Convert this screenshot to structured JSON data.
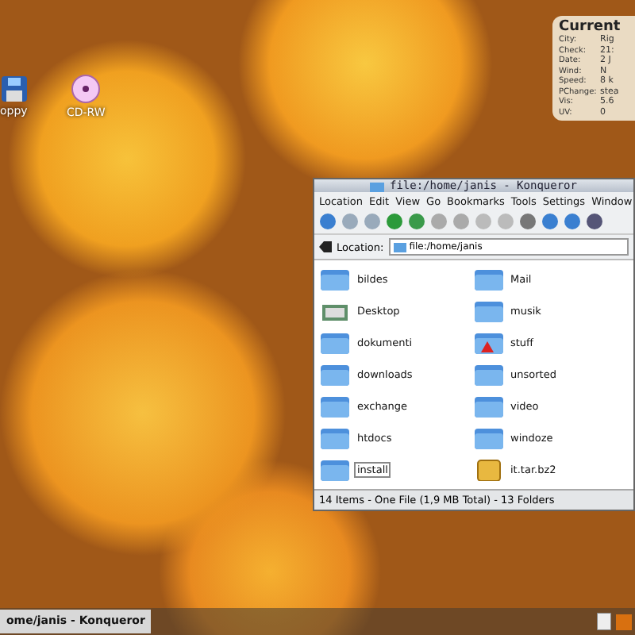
{
  "desktop_icons": [
    {
      "label": "oppy",
      "kind": "floppy"
    },
    {
      "label": "CD-RW",
      "kind": "cd"
    }
  ],
  "weather_widget": {
    "title": "Current",
    "rows": [
      {
        "label": "City:",
        "value": "Rig"
      },
      {
        "label": "Check:",
        "value": "21:"
      },
      {
        "label": "Date:",
        "value": "2 J"
      },
      {
        "label": "Wind:",
        "value": "N"
      },
      {
        "label": "Speed:",
        "value": "8 k"
      },
      {
        "label": "PChange:",
        "value": "stea"
      },
      {
        "label": "Vis:",
        "value": "5.6"
      },
      {
        "label": "UV:",
        "value": "0"
      }
    ]
  },
  "window": {
    "title": "file:/home/janis - Konqueror",
    "menu": [
      "Location",
      "Edit",
      "View",
      "Go",
      "Bookmarks",
      "Tools",
      "Settings",
      "Window"
    ],
    "location_label": "Location:",
    "location_value": "file:/home/janis",
    "files": [
      {
        "name": "bildes",
        "kind": "folder",
        "selected": false
      },
      {
        "name": "Mail",
        "kind": "folder",
        "selected": false
      },
      {
        "name": "Desktop",
        "kind": "desktop",
        "selected": false
      },
      {
        "name": "musik",
        "kind": "folder",
        "selected": false
      },
      {
        "name": "dokumenti",
        "kind": "folder",
        "selected": false
      },
      {
        "name": "stuff",
        "kind": "warning",
        "selected": false
      },
      {
        "name": "downloads",
        "kind": "folder",
        "selected": false
      },
      {
        "name": "unsorted",
        "kind": "folder",
        "selected": false
      },
      {
        "name": "exchange",
        "kind": "folder",
        "selected": false
      },
      {
        "name": "video",
        "kind": "folder",
        "selected": false
      },
      {
        "name": "htdocs",
        "kind": "folder",
        "selected": false
      },
      {
        "name": "windoze",
        "kind": "folder",
        "selected": false
      },
      {
        "name": "install",
        "kind": "folder",
        "selected": true
      },
      {
        "name": "it.tar.bz2",
        "kind": "archive",
        "selected": false
      }
    ],
    "status": "14 Items - One File (1,9 MB Total) - 13 Folders"
  },
  "taskbar": {
    "task": "ome/janis - Konqueror"
  }
}
